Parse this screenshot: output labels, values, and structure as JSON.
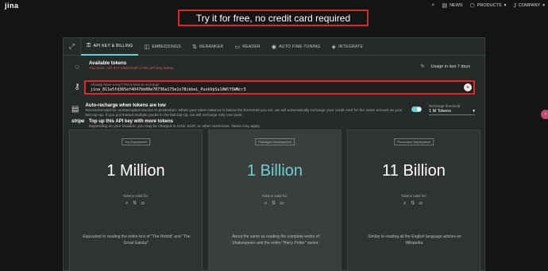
{
  "header": {
    "logo": "jina",
    "nav": [
      {
        "label": "",
        "icon": "search-icon",
        "glyph": "⌕"
      },
      {
        "label": "NEWS",
        "icon": "news-icon",
        "glyph": "▤"
      },
      {
        "label": "PRODUCTS",
        "icon": "cube-icon",
        "glyph": "⬡",
        "caret": "▾"
      },
      {
        "label": "COMPANY",
        "icon": "company-logo-icon",
        "glyph": "J",
        "caret": "▾"
      }
    ]
  },
  "banner": "Try it for free, no credit card required",
  "tabs": [
    {
      "label": "API KEY & BILLING",
      "icon": "key-icon",
      "glyph": "⚿",
      "active": true
    },
    {
      "label": "EMBEDDINGS",
      "icon": "embeddings-icon",
      "glyph": "◫",
      "active": false
    },
    {
      "label": "RERANKER",
      "icon": "reranker-icon",
      "glyph": "⇅",
      "active": false
    },
    {
      "label": "READER",
      "icon": "reader-icon",
      "glyph": "▭",
      "active": false
    },
    {
      "label": "AUTO FINE-TUNING",
      "icon": "finetune-icon",
      "glyph": "◉",
      "active": false
    },
    {
      "label": "INTEGRATE",
      "icon": "integrate-icon",
      "glyph": "◈",
      "active": false
    }
  ],
  "tokens": {
    "title": "Available tokens",
    "subtitle": "You have ~27,477 tokens left in the API key below.",
    "usage_label": "Usage in last 7 days"
  },
  "api_key": {
    "hint": "Already have a key? Put it here to recharge",
    "value": "jina_811e5fd365ef4047bb00e70736a175e1n78ikbeL_PuskVpSu10WlYSWNcr3"
  },
  "auto_recharge": {
    "title": "Auto-recharge when tokens are low",
    "desc": "Recommended for uninterrupted service in production. When your token balance is below the threshold you set, we will automatically recharge your credit card for the same amount as your last top-up. If you purchased multiple packs in the last top-up, we will recharge only one pack.",
    "threshold_label": "Recharge threshold",
    "threshold_value": "1 M Tokens"
  },
  "topup": {
    "brand": "stripe",
    "title": "Top up this API key with more tokens",
    "desc": "Depending on your location, you may be charged in USD, EUR, or other currencies. Taxes may apply."
  },
  "cards": [
    {
      "badge": "Toy Experiment",
      "amount": "1 Million",
      "valid": "Tokens valid for:",
      "icons": "⌕ ⇅ ▭",
      "desc": "Equivalent to reading the entire text of \"The Hobbit\" and \"The Great Gatsby\"."
    },
    {
      "badge": "Prototype Development",
      "amount": "1 Billion",
      "valid": "Tokens valid for:",
      "icons": "⌕ ⇅ ▭",
      "desc": "About the same as reading the complete works of Shakespeare and the entire \"Harry Potter\" series."
    },
    {
      "badge": "Production Deployment",
      "amount": "11 Billion",
      "valid": "Tokens valid for:",
      "icons": "⌕ ⇅ ▭",
      "desc": "Similar to reading all the English language articles on Wikipedia."
    }
  ],
  "colors": {
    "accent": "#6cd0d0",
    "highlight": "#d52b2b",
    "warning": "#e05a4f"
  }
}
